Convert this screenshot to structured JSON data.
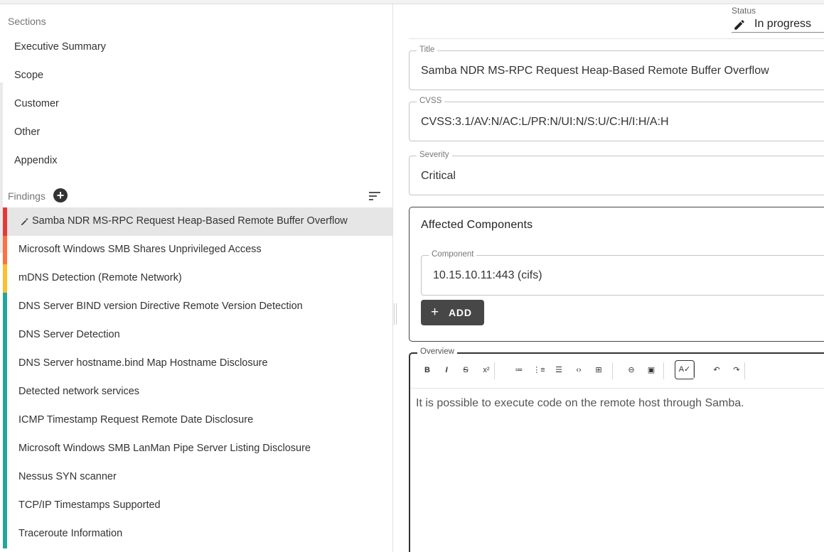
{
  "sections": {
    "header": "Sections",
    "items": [
      "Executive Summary",
      "Scope",
      "Customer",
      "Other",
      "Appendix"
    ]
  },
  "findings": {
    "header": "Findings",
    "add_icon": "plus-circle-icon",
    "sort_icon": "sort-icon",
    "items": [
      {
        "label": "Samba NDR MS-RPC Request Heap-Based Remote Buffer Overflow",
        "color": "#e53935",
        "active": true
      },
      {
        "label": "Microsoft Windows SMB Shares Unprivileged Access",
        "color": "#ff7043",
        "active": false
      },
      {
        "label": "mDNS Detection (Remote Network)",
        "color": "#fbc02d",
        "active": false
      },
      {
        "label": "DNS Server BIND version Directive Remote Version Detection",
        "color": "#26a69a",
        "active": false
      },
      {
        "label": "DNS Server Detection",
        "color": "#26a69a",
        "active": false
      },
      {
        "label": "DNS Server hostname.bind Map Hostname Disclosure",
        "color": "#26a69a",
        "active": false
      },
      {
        "label": "Detected network services",
        "color": "#26a69a",
        "active": false
      },
      {
        "label": "ICMP Timestamp Request Remote Date Disclosure",
        "color": "#26a69a",
        "active": false
      },
      {
        "label": "Microsoft Windows SMB LanMan Pipe Server Listing Disclosure",
        "color": "#26a69a",
        "active": false
      },
      {
        "label": "Nessus SYN scanner",
        "color": "#26a69a",
        "active": false
      },
      {
        "label": "TCP/IP Timestamps Supported",
        "color": "#26a69a",
        "active": false
      },
      {
        "label": "Traceroute Information",
        "color": "#26a69a",
        "active": false
      }
    ]
  },
  "status": {
    "label": "Status",
    "value": "In progress",
    "icon": "pencil-icon"
  },
  "form": {
    "title_label": "Title",
    "title_value": "Samba NDR MS-RPC Request Heap-Based Remote Buffer Overflow",
    "cvss_label": "CVSS",
    "cvss_value": "CVSS:3.1/AV:N/AC:L/PR:N/UI:N/S:U/C:H/I:H/A:H",
    "severity_label": "Severity",
    "severity_value": "Critical"
  },
  "affected": {
    "title": "Affected Components",
    "component_label": "Component",
    "component_value": "10.15.10.11:443 (cifs)",
    "add_label": "ADD",
    "add_icon": "plus-icon"
  },
  "overview": {
    "label": "Overview",
    "text": "It is possible to execute code on the remote host through Samba.",
    "toolbar": [
      {
        "name": "bold-icon",
        "glyph": "B"
      },
      {
        "name": "italic-icon",
        "glyph": "I"
      },
      {
        "name": "strikethrough-icon",
        "glyph": "S"
      },
      {
        "name": "superscript-icon",
        "glyph": "x²"
      },
      {
        "name": "bullet-list-icon",
        "glyph": "≔"
      },
      {
        "name": "numbered-list-icon",
        "glyph": "⋮≡"
      },
      {
        "name": "checklist-icon",
        "glyph": "☰"
      },
      {
        "name": "code-icon",
        "glyph": "‹›"
      },
      {
        "name": "table-icon",
        "glyph": "⊞"
      },
      {
        "name": "link-icon",
        "glyph": "⊖"
      },
      {
        "name": "image-icon",
        "glyph": "▣"
      },
      {
        "name": "spellcheck-icon",
        "glyph": "A✓"
      },
      {
        "name": "undo-icon",
        "glyph": "↶"
      },
      {
        "name": "redo-icon",
        "glyph": "↷"
      }
    ]
  },
  "theme": {
    "accent_dark": "#474747",
    "critical": "#e53935",
    "high": "#ff7043",
    "medium": "#fbc02d",
    "info": "#26a69a"
  }
}
